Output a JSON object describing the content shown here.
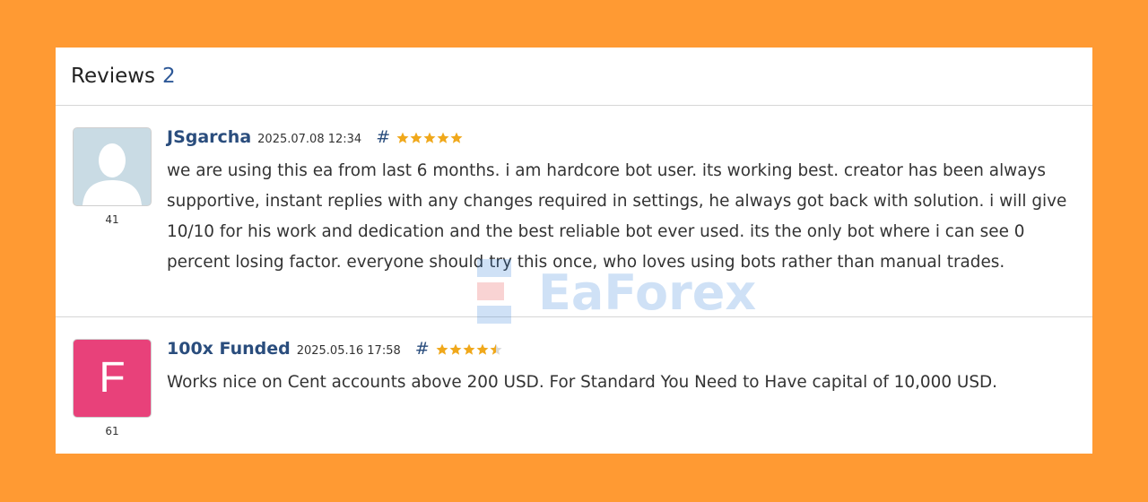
{
  "header": {
    "title": "Reviews",
    "count": "2"
  },
  "reviews": [
    {
      "author": "JSgarcha",
      "date": "2025.07.08 12:34",
      "hash": "#",
      "rating": 5,
      "avatar_rating": "41",
      "avatar_type": "default",
      "text": "we are using this ea from last 6 months. i am hardcore bot user. its working best. creator has been always supportive, instant replies with any changes required in settings, he always got back with solution. i will give 10/10 for his work and dedication and the best reliable bot ever used. its the only bot where i can see 0 percent losing factor. everyone should try this once, who loves using bots rather than manual trades."
    },
    {
      "author": "100x Funded",
      "date": "2025.05.16 17:58",
      "hash": "#",
      "rating": 4.5,
      "avatar_rating": "61",
      "avatar_type": "letter",
      "avatar_letter": "F",
      "text": "Works nice on Cent accounts above 200 USD. For Standard You Need to Have capital of 10,000 USD."
    }
  ],
  "watermark": {
    "text": "EaForex"
  },
  "colors": {
    "background": "#ff9a33",
    "accent": "#2a4d7d",
    "star": "#f0a81b",
    "avatar_letter_bg": "#e8417a"
  }
}
